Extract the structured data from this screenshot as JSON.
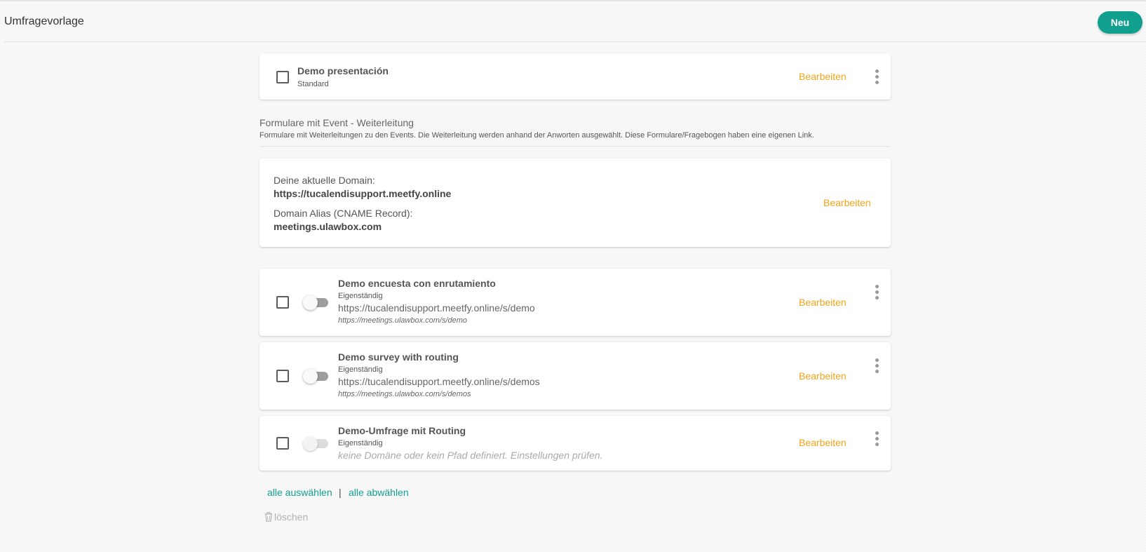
{
  "header": {
    "title": "Umfragevorlage",
    "new_label": "Neu"
  },
  "standard_item": {
    "title": "Demo presentación",
    "subtitle": "Standard",
    "edit_label": "Bearbeiten"
  },
  "section": {
    "title": "Formulare mit Event - Weiterleitung",
    "description": "Formulare mit Weiterleitungen zu den Events. Die Weiterleitung werden anhand der Anworten ausgewählt. Diese Formulare/Fragebogen haben eine eigenen Link."
  },
  "domain": {
    "current_label": "Deine aktuelle Domain:",
    "current_value": "https://tucalendisupport.meetfy.online",
    "alias_label": "Domain Alias (CNAME Record):",
    "alias_value": "meetings.ulawbox.com",
    "edit_label": "Bearbeiten"
  },
  "forms": [
    {
      "title": "Demo encuesta con enrutamiento",
      "subtitle": "Eigenständig",
      "url": "https://tucalendisupport.meetfy.online/s/demo",
      "alias_url": "https://meetings.ulawbox.com/s/demo",
      "edit_label": "Bearbeiten"
    },
    {
      "title": "Demo survey with routing",
      "subtitle": "Eigenständig",
      "url": "https://tucalendisupport.meetfy.online/s/demos",
      "alias_url": "https://meetings.ulawbox.com/s/demos",
      "edit_label": "Bearbeiten"
    },
    {
      "title": "Demo-Umfrage mit Routing",
      "subtitle": "Eigenständig",
      "warning": "keine Domäne oder kein Pfad definiert. Einstellungen prüfen.",
      "edit_label": "Bearbeiten"
    }
  ],
  "bulk": {
    "select_all": "alle auswählen",
    "separator": "|",
    "deselect_all": "alle abwählen",
    "delete_label": "löschen"
  },
  "colors": {
    "accent": "#12a08e",
    "edit": "#f2a41a"
  }
}
